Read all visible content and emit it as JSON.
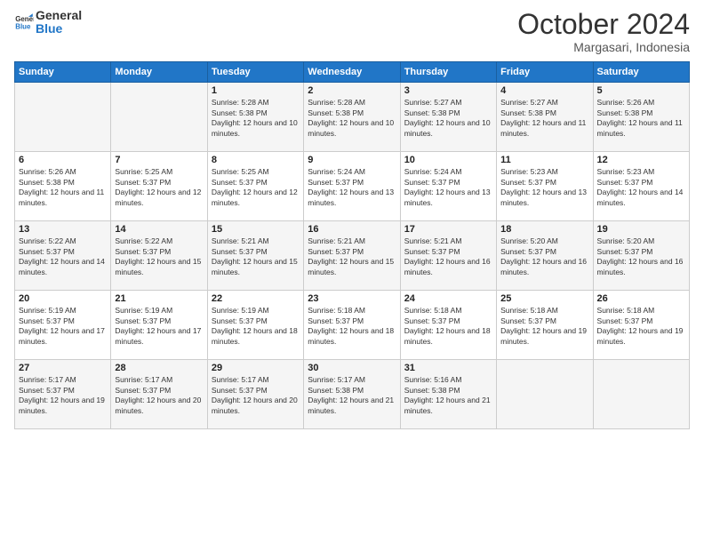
{
  "logo": {
    "line1": "General",
    "line2": "Blue"
  },
  "title": "October 2024",
  "location": "Margasari, Indonesia",
  "days_header": [
    "Sunday",
    "Monday",
    "Tuesday",
    "Wednesday",
    "Thursday",
    "Friday",
    "Saturday"
  ],
  "weeks": [
    [
      {
        "num": "",
        "sunrise": "",
        "sunset": "",
        "daylight": ""
      },
      {
        "num": "",
        "sunrise": "",
        "sunset": "",
        "daylight": ""
      },
      {
        "num": "1",
        "sunrise": "Sunrise: 5:28 AM",
        "sunset": "Sunset: 5:38 PM",
        "daylight": "Daylight: 12 hours and 10 minutes."
      },
      {
        "num": "2",
        "sunrise": "Sunrise: 5:28 AM",
        "sunset": "Sunset: 5:38 PM",
        "daylight": "Daylight: 12 hours and 10 minutes."
      },
      {
        "num": "3",
        "sunrise": "Sunrise: 5:27 AM",
        "sunset": "Sunset: 5:38 PM",
        "daylight": "Daylight: 12 hours and 10 minutes."
      },
      {
        "num": "4",
        "sunrise": "Sunrise: 5:27 AM",
        "sunset": "Sunset: 5:38 PM",
        "daylight": "Daylight: 12 hours and 11 minutes."
      },
      {
        "num": "5",
        "sunrise": "Sunrise: 5:26 AM",
        "sunset": "Sunset: 5:38 PM",
        "daylight": "Daylight: 12 hours and 11 minutes."
      }
    ],
    [
      {
        "num": "6",
        "sunrise": "Sunrise: 5:26 AM",
        "sunset": "Sunset: 5:38 PM",
        "daylight": "Daylight: 12 hours and 11 minutes."
      },
      {
        "num": "7",
        "sunrise": "Sunrise: 5:25 AM",
        "sunset": "Sunset: 5:37 PM",
        "daylight": "Daylight: 12 hours and 12 minutes."
      },
      {
        "num": "8",
        "sunrise": "Sunrise: 5:25 AM",
        "sunset": "Sunset: 5:37 PM",
        "daylight": "Daylight: 12 hours and 12 minutes."
      },
      {
        "num": "9",
        "sunrise": "Sunrise: 5:24 AM",
        "sunset": "Sunset: 5:37 PM",
        "daylight": "Daylight: 12 hours and 13 minutes."
      },
      {
        "num": "10",
        "sunrise": "Sunrise: 5:24 AM",
        "sunset": "Sunset: 5:37 PM",
        "daylight": "Daylight: 12 hours and 13 minutes."
      },
      {
        "num": "11",
        "sunrise": "Sunrise: 5:23 AM",
        "sunset": "Sunset: 5:37 PM",
        "daylight": "Daylight: 12 hours and 13 minutes."
      },
      {
        "num": "12",
        "sunrise": "Sunrise: 5:23 AM",
        "sunset": "Sunset: 5:37 PM",
        "daylight": "Daylight: 12 hours and 14 minutes."
      }
    ],
    [
      {
        "num": "13",
        "sunrise": "Sunrise: 5:22 AM",
        "sunset": "Sunset: 5:37 PM",
        "daylight": "Daylight: 12 hours and 14 minutes."
      },
      {
        "num": "14",
        "sunrise": "Sunrise: 5:22 AM",
        "sunset": "Sunset: 5:37 PM",
        "daylight": "Daylight: 12 hours and 15 minutes."
      },
      {
        "num": "15",
        "sunrise": "Sunrise: 5:21 AM",
        "sunset": "Sunset: 5:37 PM",
        "daylight": "Daylight: 12 hours and 15 minutes."
      },
      {
        "num": "16",
        "sunrise": "Sunrise: 5:21 AM",
        "sunset": "Sunset: 5:37 PM",
        "daylight": "Daylight: 12 hours and 15 minutes."
      },
      {
        "num": "17",
        "sunrise": "Sunrise: 5:21 AM",
        "sunset": "Sunset: 5:37 PM",
        "daylight": "Daylight: 12 hours and 16 minutes."
      },
      {
        "num": "18",
        "sunrise": "Sunrise: 5:20 AM",
        "sunset": "Sunset: 5:37 PM",
        "daylight": "Daylight: 12 hours and 16 minutes."
      },
      {
        "num": "19",
        "sunrise": "Sunrise: 5:20 AM",
        "sunset": "Sunset: 5:37 PM",
        "daylight": "Daylight: 12 hours and 16 minutes."
      }
    ],
    [
      {
        "num": "20",
        "sunrise": "Sunrise: 5:19 AM",
        "sunset": "Sunset: 5:37 PM",
        "daylight": "Daylight: 12 hours and 17 minutes."
      },
      {
        "num": "21",
        "sunrise": "Sunrise: 5:19 AM",
        "sunset": "Sunset: 5:37 PM",
        "daylight": "Daylight: 12 hours and 17 minutes."
      },
      {
        "num": "22",
        "sunrise": "Sunrise: 5:19 AM",
        "sunset": "Sunset: 5:37 PM",
        "daylight": "Daylight: 12 hours and 18 minutes."
      },
      {
        "num": "23",
        "sunrise": "Sunrise: 5:18 AM",
        "sunset": "Sunset: 5:37 PM",
        "daylight": "Daylight: 12 hours and 18 minutes."
      },
      {
        "num": "24",
        "sunrise": "Sunrise: 5:18 AM",
        "sunset": "Sunset: 5:37 PM",
        "daylight": "Daylight: 12 hours and 18 minutes."
      },
      {
        "num": "25",
        "sunrise": "Sunrise: 5:18 AM",
        "sunset": "Sunset: 5:37 PM",
        "daylight": "Daylight: 12 hours and 19 minutes."
      },
      {
        "num": "26",
        "sunrise": "Sunrise: 5:18 AM",
        "sunset": "Sunset: 5:37 PM",
        "daylight": "Daylight: 12 hours and 19 minutes."
      }
    ],
    [
      {
        "num": "27",
        "sunrise": "Sunrise: 5:17 AM",
        "sunset": "Sunset: 5:37 PM",
        "daylight": "Daylight: 12 hours and 19 minutes."
      },
      {
        "num": "28",
        "sunrise": "Sunrise: 5:17 AM",
        "sunset": "Sunset: 5:37 PM",
        "daylight": "Daylight: 12 hours and 20 minutes."
      },
      {
        "num": "29",
        "sunrise": "Sunrise: 5:17 AM",
        "sunset": "Sunset: 5:37 PM",
        "daylight": "Daylight: 12 hours and 20 minutes."
      },
      {
        "num": "30",
        "sunrise": "Sunrise: 5:17 AM",
        "sunset": "Sunset: 5:38 PM",
        "daylight": "Daylight: 12 hours and 21 minutes."
      },
      {
        "num": "31",
        "sunrise": "Sunrise: 5:16 AM",
        "sunset": "Sunset: 5:38 PM",
        "daylight": "Daylight: 12 hours and 21 minutes."
      },
      {
        "num": "",
        "sunrise": "",
        "sunset": "",
        "daylight": ""
      },
      {
        "num": "",
        "sunrise": "",
        "sunset": "",
        "daylight": ""
      }
    ]
  ]
}
